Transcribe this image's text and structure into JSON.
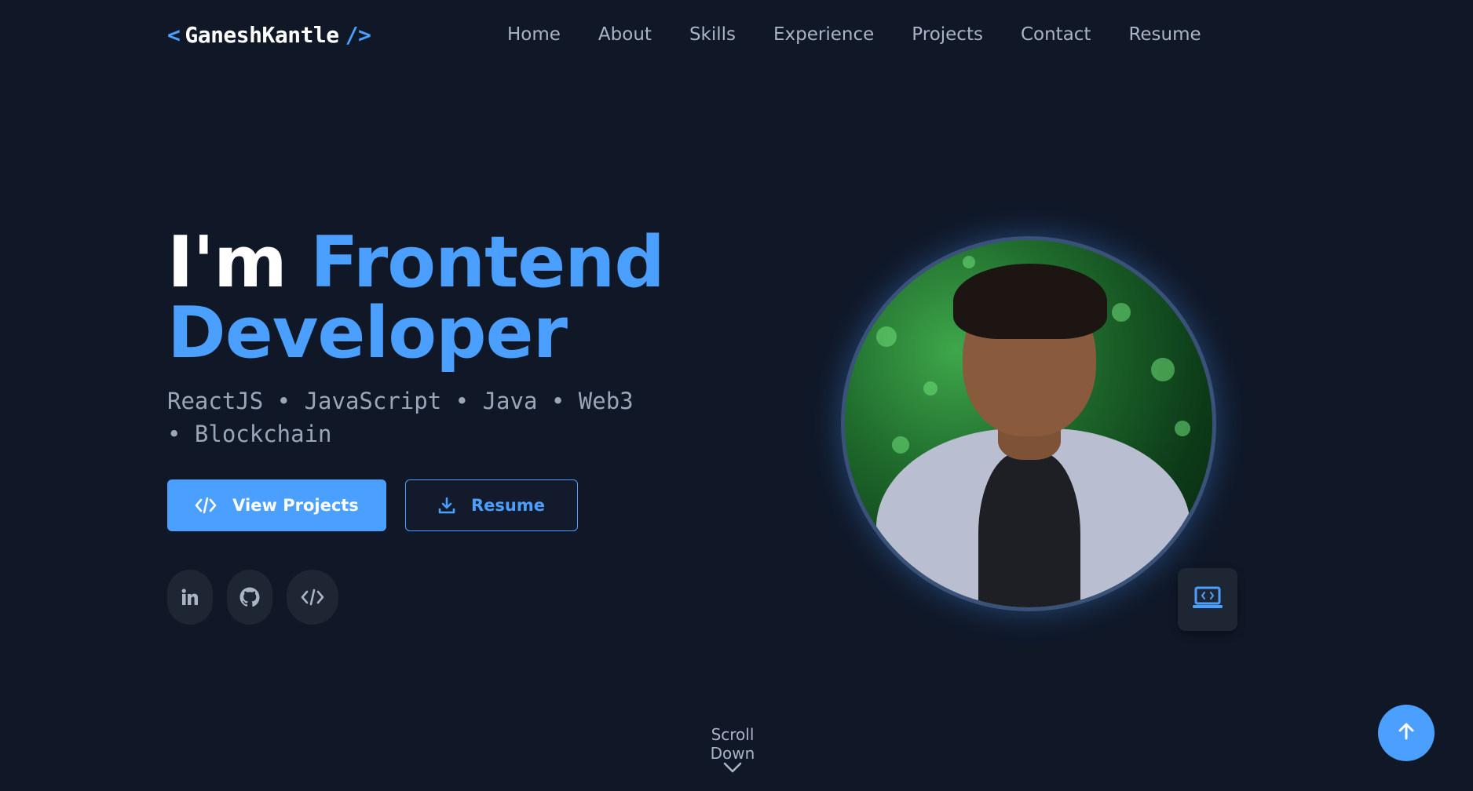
{
  "logo": {
    "open_bracket": "<",
    "name": "GaneshKantle",
    "close_bracket": "/>"
  },
  "nav": {
    "items": [
      {
        "label": "Home"
      },
      {
        "label": "About"
      },
      {
        "label": "Skills"
      },
      {
        "label": "Experience"
      },
      {
        "label": "Projects"
      },
      {
        "label": "Contact"
      },
      {
        "label": "Resume"
      }
    ]
  },
  "hero": {
    "headline_prefix": "I'm",
    "headline_accent_1": "Frontend",
    "headline_accent_2": "Developer",
    "skills_line": "ReactJS • JavaScript • Java • Web3 • Blockchain",
    "primary_button": {
      "label": "View Projects",
      "icon": "code-icon"
    },
    "secondary_button": {
      "label": "Resume",
      "icon": "download-icon"
    },
    "socials": [
      {
        "icon": "linkedin-icon"
      },
      {
        "icon": "github-icon"
      },
      {
        "icon": "code-icon"
      }
    ],
    "avatar": {
      "icon": "profile-photo"
    },
    "badge_icon": "laptop-code-icon"
  },
  "scroll_down": {
    "label": "Scroll Down",
    "icon": "chevron-down-icon"
  },
  "back_to_top": {
    "icon": "arrow-up-icon"
  },
  "colors": {
    "background": "#101828",
    "accent": "#4a9fff",
    "text_primary": "#ffffff",
    "text_muted": "#aab4c4"
  }
}
